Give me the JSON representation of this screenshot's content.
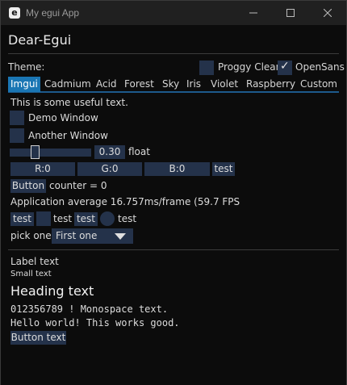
{
  "window": {
    "title": "My egui App",
    "icon_letter": "e",
    "minimize_glyph": "—",
    "maximize_glyph": "☐",
    "close_glyph": "✕"
  },
  "header": {
    "title": "Dear-Egui"
  },
  "theme": {
    "label": "Theme:",
    "proggy_label": "Proggy Clean",
    "opensans_label": "OpenSans",
    "proggy_checked": false,
    "opensans_checked": true
  },
  "tabs": [
    {
      "label": "Imgui",
      "active": true
    },
    {
      "label": "Cadmium"
    },
    {
      "label": "Acid"
    },
    {
      "label": "Forest"
    },
    {
      "label": "Sky"
    },
    {
      "label": "Iris"
    },
    {
      "label": "Violet"
    },
    {
      "label": "Raspberry"
    },
    {
      "label": "Custom"
    }
  ],
  "main": {
    "useful_text": "This is some useful text.",
    "demo_window_label": "Demo Window",
    "another_window_label": "Another Window",
    "slider_value": "0.30",
    "slider_label": "float",
    "slider_fraction": 0.3,
    "r_label": "R:0",
    "g_label": "G:0",
    "b_label": "B:0",
    "color_test_label": "test",
    "button_label": "Button",
    "counter_text": "counter = 0",
    "perf_text": "Application average 16.757ms/frame (59.7 FPS",
    "test_btn_label": "test",
    "test_cb_label": "test",
    "test_btn2_label": "test",
    "test_radio_label": "test",
    "pick_label": "pick one:",
    "pick_value": "First one"
  },
  "text_demo": {
    "label_text": "Label text",
    "small_text": "Small text",
    "heading_text": "Heading text",
    "mono_line": "012356789  ! Monospace text.",
    "hello_line": "Hello world! This works good.",
    "button_text": "Button text"
  },
  "colors": {
    "widget_bg": "#24324a",
    "accent": "#1a76b4",
    "background": "#0c0c0c"
  }
}
